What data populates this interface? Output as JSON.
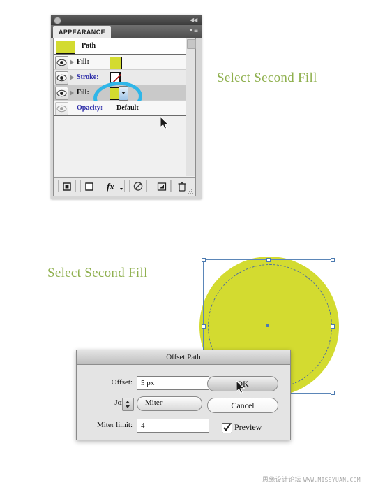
{
  "panel": {
    "tab_label": "APPEARANCE",
    "menu_icon": "panel-menu-icon",
    "collapse_icon": "collapse-chevrons-icon",
    "header": {
      "title": "Path",
      "thumb_color": "#d3db30"
    },
    "rows": [
      {
        "label": "Fill:",
        "type": "fill",
        "swatch_color": "#d3db30",
        "visible": true,
        "selected": false
      },
      {
        "label": "Stroke:",
        "type": "stroke",
        "swatch_color": "none",
        "visible": true,
        "selected": false
      },
      {
        "label": "Fill:",
        "type": "fill",
        "swatch_color": "#d3db30",
        "visible": true,
        "selected": true
      },
      {
        "label": "Opacity:",
        "type": "opacity",
        "value": "Default",
        "visible": true,
        "selected": false
      }
    ],
    "footer_buttons": [
      {
        "name": "add-new-stroke-button",
        "icon": "filled-square-icon"
      },
      {
        "name": "add-new-fill-button",
        "icon": "empty-square-icon"
      },
      {
        "name": "add-new-effect-button",
        "icon": "fx-icon"
      },
      {
        "name": "clear-appearance-button",
        "icon": "no-symbol-icon"
      },
      {
        "name": "duplicate-item-button",
        "icon": "duplicate-icon"
      },
      {
        "name": "delete-item-button",
        "icon": "trash-icon"
      }
    ],
    "highlight": {
      "color": "#2fb6e8",
      "shape": "ellipse"
    }
  },
  "annotations": {
    "heading_top": "Select Second Fill",
    "heading_bottom": "Select Second Fill",
    "heading_color": "#8fb04e"
  },
  "artwork": {
    "shape": "circle",
    "fill_color": "#d3db30",
    "selection_color": "#5b86b8",
    "path_outline": "dashed-inner-circle"
  },
  "dialog": {
    "title": "Offset Path",
    "fields": [
      {
        "label": "Offset:",
        "value": "5 px"
      },
      {
        "label": "Joins:",
        "value": "Miter"
      },
      {
        "label": "Miter limit:",
        "value": "4"
      }
    ],
    "offset_label": "Offset:",
    "offset_value": "5 px",
    "joins_label": "Joins:",
    "joins_value": "Miter",
    "miter_label": "Miter limit:",
    "miter_value": "4",
    "ok_label": "OK",
    "cancel_label": "Cancel",
    "preview_label": "Preview",
    "preview_checked": true
  },
  "watermark": {
    "site_name": "思缘设计论坛",
    "url": "WWW.MISSYUAN.COM"
  }
}
